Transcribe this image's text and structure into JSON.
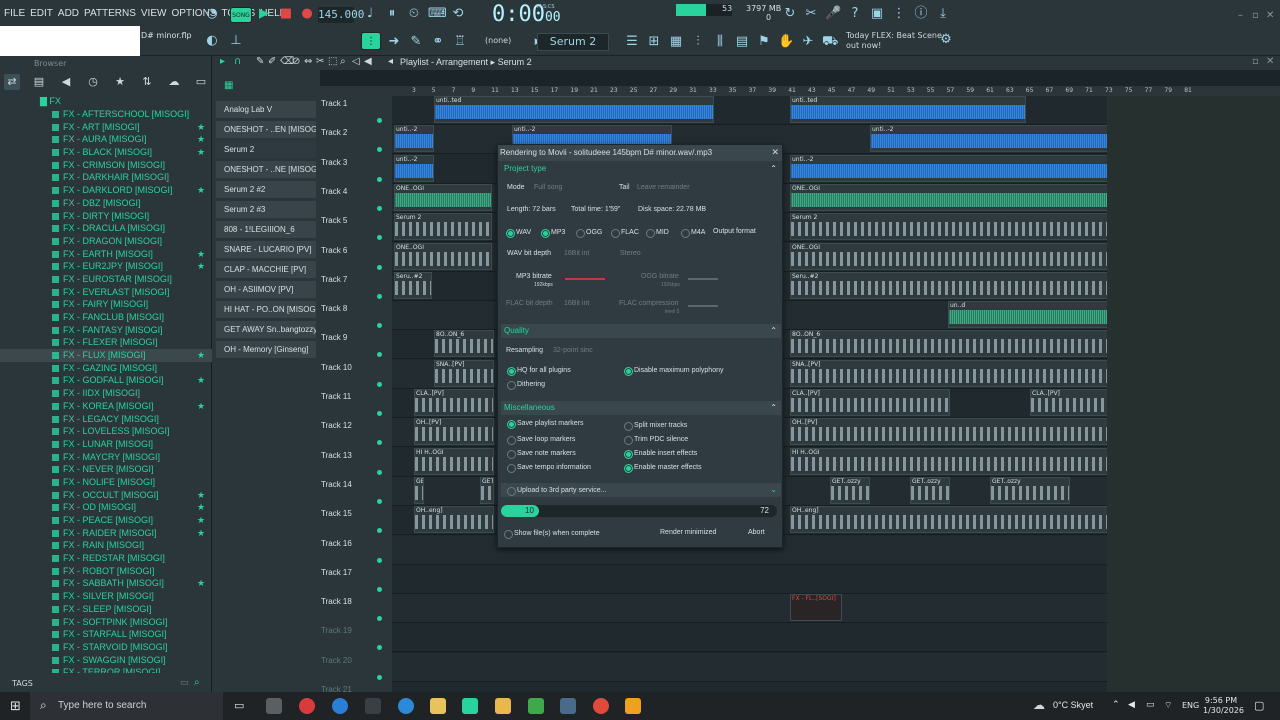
{
  "menu": [
    "FILE",
    "EDIT",
    "ADD",
    "PATTERNS",
    "VIEW",
    "OPTIONS",
    "TOOLS",
    "HELP"
  ],
  "transport": {
    "mode": "SONG",
    "tempo": "145.000",
    "time": "0:00",
    "time_sub": "00",
    "time_label": "M:S:CS"
  },
  "monitor": {
    "cpu": "53",
    "cpu_fill": 0.53,
    "ram": "3797 MB",
    "polyphony": "0"
  },
  "pattern": {
    "name": "Serum 2",
    "none_label": "(none)"
  },
  "news": {
    "line1": "Today  FLEX: Beat Scene",
    "line2": "out now!"
  },
  "project_title": "D# minor.flp",
  "browser": {
    "header": "Browser",
    "folder": "FX",
    "selected_index": 19,
    "items": [
      {
        "label": "FX - AFTERSCHOOL [MISOGI]",
        "star": false
      },
      {
        "label": "FX - ART [MISOGI]",
        "star": true
      },
      {
        "label": "FX - AURA [MISOGI]",
        "star": true
      },
      {
        "label": "FX - BLACK [MISOGI]",
        "star": true
      },
      {
        "label": "FX - CRIMSON [MISOGI]",
        "star": false
      },
      {
        "label": "FX - DARKHAIR [MISOGI]",
        "star": false
      },
      {
        "label": "FX - DARKLORD [MISOGI]",
        "star": true
      },
      {
        "label": "FX - DBZ [MISOGI]",
        "star": false
      },
      {
        "label": "FX - DIRTY [MISOGI]",
        "star": false
      },
      {
        "label": "FX - DRACULA [MISOGI]",
        "star": false
      },
      {
        "label": "FX - DRAGON [MISOGI]",
        "star": false
      },
      {
        "label": "FX - EARTH [MISOGI]",
        "star": true
      },
      {
        "label": "FX - EUR2JPY [MISOGI]",
        "star": true
      },
      {
        "label": "FX - EUROSTAR [MISOGI]",
        "star": false
      },
      {
        "label": "FX - EVERLAST [MISOGI]",
        "star": false
      },
      {
        "label": "FX - FAIRY [MISOGI]",
        "star": false
      },
      {
        "label": "FX - FANCLUB [MISOGI]",
        "star": false
      },
      {
        "label": "FX - FANTASY [MISOGI]",
        "star": false
      },
      {
        "label": "FX - FLEXER [MISOGI]",
        "star": false
      },
      {
        "label": "FX - FLUX [MISOGI]",
        "star": true
      },
      {
        "label": "FX - GAZING [MISOGI]",
        "star": false
      },
      {
        "label": "FX - GODFALL [MISOGI]",
        "star": true
      },
      {
        "label": "FX - IIDX [MISOGI]",
        "star": false
      },
      {
        "label": "FX - KOREA [MISOGI]",
        "star": true
      },
      {
        "label": "FX - LEGACY [MISOGI]",
        "star": false
      },
      {
        "label": "FX - LOVELESS [MISOGI]",
        "star": false
      },
      {
        "label": "FX - LUNAR [MISOGI]",
        "star": false
      },
      {
        "label": "FX - MAYCRY [MISOGI]",
        "star": false
      },
      {
        "label": "FX - NEVER [MISOGI]",
        "star": false
      },
      {
        "label": "FX - NOLIFE [MISOGI]",
        "star": false
      },
      {
        "label": "FX - OCCULT [MISOGI]",
        "star": true
      },
      {
        "label": "FX - OD [MISOGI]",
        "star": true
      },
      {
        "label": "FX - PEACE [MISOGI]",
        "star": true
      },
      {
        "label": "FX - RAIDER [MISOGI]",
        "star": true
      },
      {
        "label": "FX - RAIN [MISOGI]",
        "star": false
      },
      {
        "label": "FX - REDSTAR [MISOGI]",
        "star": false
      },
      {
        "label": "FX - ROBOT [MISOGI]",
        "star": false
      },
      {
        "label": "FX - SABBATH [MISOGI]",
        "star": true
      },
      {
        "label": "FX - SILVER [MISOGI]",
        "star": false
      },
      {
        "label": "FX - SLEEP [MISOGI]",
        "star": false
      },
      {
        "label": "FX - SOFTPINK [MISOGI]",
        "star": false
      },
      {
        "label": "FX - STARFALL [MISOGI]",
        "star": false
      },
      {
        "label": "FX - STARVOID [MISOGI]",
        "star": false
      },
      {
        "label": "FX - SWAGGIN [MISOGI]",
        "star": false
      },
      {
        "label": "FX - TERROR [MISOGI]",
        "star": false
      }
    ],
    "tags_label": "TAGS"
  },
  "channels": [
    "Analog Lab V",
    "ONESHOT - ..EN [MISOGI]",
    "Serum 2",
    "ONESHOT - ..NE [MISOGI]",
    "Serum 2 #2",
    "Serum 2 #3",
    "808 - 1!LEGIIION_6",
    "SNARE - LUCARIO [PV]",
    "CLAP - MACCHIE [PV]",
    "OH - ASIIMOV [PV]",
    "HI HAT - PO..ON [MISOGI]",
    "GET AWAY Sn..bangtozzy",
    "OH - Memory [Ginseng]"
  ],
  "playlist": {
    "title": "Playlist - Arrangement",
    "pattern": "Serum 2",
    "tracks": [
      "Track 1",
      "Track 2",
      "Track 3",
      "Track 4",
      "Track 5",
      "Track 6",
      "Track 7",
      "Track 8",
      "Track 9",
      "Track 10",
      "Track 11",
      "Track 12",
      "Track 13",
      "Track 14",
      "Track 15",
      "Track 16",
      "Track 17",
      "Track 18",
      "Track 19",
      "Track 20",
      "Track 21"
    ],
    "ruler": [
      "3",
      "5",
      "7",
      "9",
      "11",
      "13",
      "15",
      "17",
      "19",
      "21",
      "23",
      "25",
      "27",
      "29",
      "31",
      "33",
      "35",
      "37",
      "39",
      "41",
      "43",
      "45",
      "47",
      "49",
      "51",
      "53",
      "55",
      "57",
      "59",
      "61",
      "63",
      "65",
      "67",
      "69",
      "71",
      "73",
      "75",
      "77",
      "79",
      "81"
    ],
    "clip_labels": {
      "t1": "unti..ted",
      "t2": "unti..-2",
      "t4": "ONE..OGI",
      "t5": "Serum 2",
      "t7": "Seru..#2",
      "t8": "un..d",
      "t9": "8O..ON_6",
      "t10": "SNA..[PV]",
      "t11": "CLA..[PV]",
      "t12": "OH..[PV]",
      "t13": "HI H..OGI",
      "t14": "GET..ozzy",
      "t15": "OH..eng]",
      "t18": "FX - FL..[SOGI]"
    }
  },
  "render": {
    "title": "Rendering to Movii - solitudeee 145bpm D# minor.wav/.mp3",
    "project_type": "Project type",
    "mode_label": "Mode",
    "mode_value": "Full song",
    "tail_label": "Tail",
    "tail_value": "Leave remainder",
    "length": "Length: 72 bars",
    "total_time": "Total time: 1'59\"",
    "disk_space": "Disk space: 22.78 MB",
    "formats": [
      {
        "label": "WAV",
        "on": true
      },
      {
        "label": "MP3",
        "on": true
      },
      {
        "label": "OGG",
        "on": false
      },
      {
        "label": "FLAC",
        "on": false
      },
      {
        "label": "MID",
        "on": false
      },
      {
        "label": "M4A",
        "on": false
      }
    ],
    "output_format": "Output format",
    "wav_bit_depth_label": "WAV bit depth",
    "wav_bit_depth_value": "16Bit int",
    "stereo": "Stereo",
    "mp3_bitrate_label": "MP3 bitrate",
    "mp3_bitrate_value": "192kbps",
    "ogg_bitrate_label": "OGG bitrate",
    "ogg_bitrate_value": "192kbps",
    "flac_bit_depth_label": "FLAC bit depth",
    "flac_bit_depth_value": "16Bit int",
    "flac_compression_label": "FLAC compression",
    "flac_compression_value": "level 5",
    "quality": "Quality",
    "resampling_label": "Resampling",
    "resampling_value": "32-point sinc",
    "hq_plugins": "HQ for all plugins",
    "disable_max_poly": "Disable maximum polyphony",
    "dithering": "Dithering",
    "misc": "Miscellaneous",
    "save_playlist_markers": "Save playlist markers",
    "split_mixer_tracks": "Split mixer tracks",
    "save_loop_markers": "Save loop markers",
    "trim_pdc": "Trim PDC silence",
    "save_note_markers": "Save note markers",
    "enable_insert_fx": "Enable insert effects",
    "save_tempo_info": "Save tempo information",
    "enable_master_fx": "Enable master effects",
    "upload": "Upload to 3rd party service...",
    "progress_current": "10",
    "progress_total": "72",
    "progress_fraction": 0.139,
    "show_files": "Show file(s) when complete",
    "render_minimized": "Render minimized",
    "abort": "Abort"
  },
  "taskbar": {
    "search_placeholder": "Type here to search",
    "weather": "0°C  Skyet",
    "lang": "ENG",
    "time": "9:56 PM",
    "date": "1/30/2026"
  }
}
